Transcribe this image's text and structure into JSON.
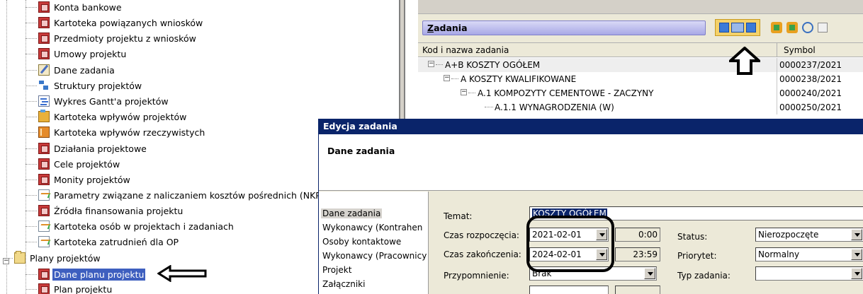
{
  "tree": {
    "items": [
      {
        "label": "Konta bankowe",
        "icon": "form-icon"
      },
      {
        "label": "Kartoteka powiązanych wniosków",
        "icon": "form-icon"
      },
      {
        "label": "Przedmioty projektu z wniosków",
        "icon": "form-icon"
      },
      {
        "label": "Umowy projektu",
        "icon": "form-icon"
      },
      {
        "label": "Dane zadania",
        "icon": "edit-icon"
      },
      {
        "label": "Struktury projektów",
        "icon": "structure-icon"
      },
      {
        "label": "Wykres Gantt'a projektów",
        "icon": "gantt-icon"
      },
      {
        "label": "Kartoteka wpływów projektów",
        "icon": "folder-color-icon"
      },
      {
        "label": "Kartoteka wpływów rzeczywistych",
        "icon": "book-icon"
      },
      {
        "label": "Działania projektowe",
        "icon": "form-icon"
      },
      {
        "label": "Cele projektów",
        "icon": "form-icon"
      },
      {
        "label": "Monity projektów",
        "icon": "form-icon"
      },
      {
        "label": "Parametry związane z naliczaniem kosztów pośrednich (NKP)",
        "icon": "chart-icon"
      },
      {
        "label": "Źródła finansowania projektu",
        "icon": "form-icon"
      },
      {
        "label": "Kartoteka osób w projektach i zadaniach",
        "icon": "chart-icon"
      },
      {
        "label": "Kartoteka zatrudnień dla OP",
        "icon": "chart-icon"
      }
    ],
    "group_label": "Plany projektów",
    "group_items": [
      {
        "label": "Dane planu projektu",
        "icon": "form-icon"
      },
      {
        "label": "Plan projektu",
        "icon": "form-icon"
      }
    ]
  },
  "tasks": {
    "header_underlined": "Z",
    "header_rest": "adania",
    "columns": [
      "Kod i nazwa zadania",
      "Symbol"
    ],
    "rows": [
      {
        "name": "A+B KOSZTY OGÓŁEM",
        "symbol": "0000237/2021"
      },
      {
        "name": "A KOSZTY KWALIFIKOWANE",
        "symbol": "0000238/2021"
      },
      {
        "name": "A.1 KOMPOZYTY CEMENTOWE - ZACZYNY",
        "symbol": "0000240/2021"
      },
      {
        "name": "A.1.1 WYNAGRODZENIA (W)",
        "symbol": "0000250/2021"
      }
    ]
  },
  "dialog": {
    "title": "Edycja zadania",
    "banner_title": "Dane zadania",
    "nav": [
      "Dane zadania",
      "Wykonawcy (Kontrahen",
      "Osoby kontaktowe",
      "Wykonawcy (Pracownicy",
      "Projekt",
      "Załączniki"
    ],
    "form": {
      "temat_label": "Temat:",
      "temat_value": "KOSZTY OGÓŁEM",
      "start_label": "Czas rozpoczęcia:",
      "start_date": "2021-02-01",
      "start_time": "0:00",
      "end_label": "Czas zakończenia:",
      "end_date": "2024-02-01",
      "end_time": "23:59",
      "reminder_label": "Przypomnienie:",
      "reminder_value": "Brak",
      "status_label": "Status:",
      "status_value": "Nierozpoczęte",
      "priority_label": "Priorytet:",
      "priority_value": "Normalny",
      "type_label": "Typ zadania:",
      "type_value": ""
    }
  }
}
